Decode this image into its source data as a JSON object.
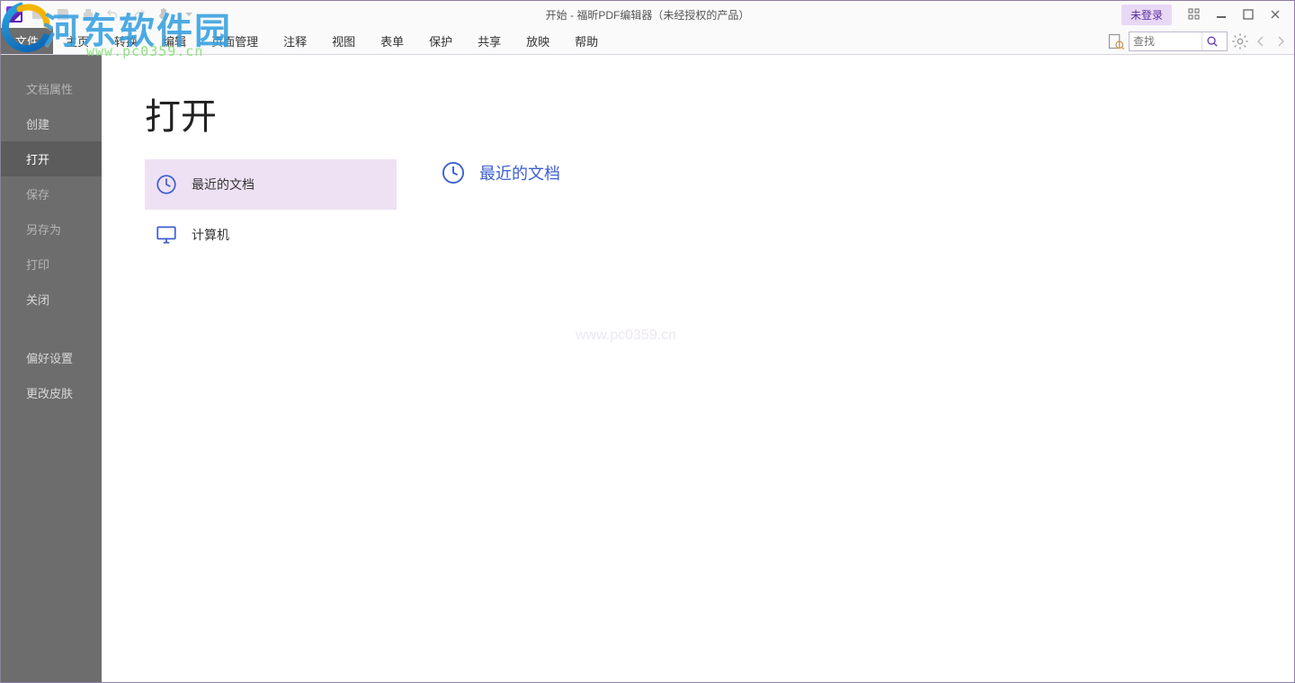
{
  "titlebar": {
    "title": "开始 - 福昕PDF编辑器（未经授权的产品）",
    "login": "未登录"
  },
  "ribbon": {
    "file": "文件",
    "tabs": [
      "主页",
      "转换",
      "编辑",
      "页面管理",
      "注释",
      "视图",
      "表单",
      "保护",
      "共享",
      "放映",
      "帮助"
    ],
    "search_placeholder": "查找"
  },
  "sidebar": {
    "items": [
      {
        "label": "文档属性",
        "dim": true
      },
      {
        "label": "创建"
      },
      {
        "label": "打开",
        "selected": true
      },
      {
        "label": "保存",
        "dim": true
      },
      {
        "label": "另存为",
        "dim": true
      },
      {
        "label": "打印",
        "dim": true
      },
      {
        "label": "关闭"
      },
      {
        "label": "偏好设置",
        "spaced": true
      },
      {
        "label": "更改皮肤"
      }
    ]
  },
  "content": {
    "heading": "打开",
    "locations": [
      {
        "label": "最近的文档",
        "icon": "clock",
        "active": true
      },
      {
        "label": "计算机",
        "icon": "computer"
      }
    ],
    "panel_title": "最近的文档"
  },
  "watermark": {
    "text": "河东软件园",
    "url": "www.pc0359.cn",
    "faint": "www.pc0359.cn"
  }
}
